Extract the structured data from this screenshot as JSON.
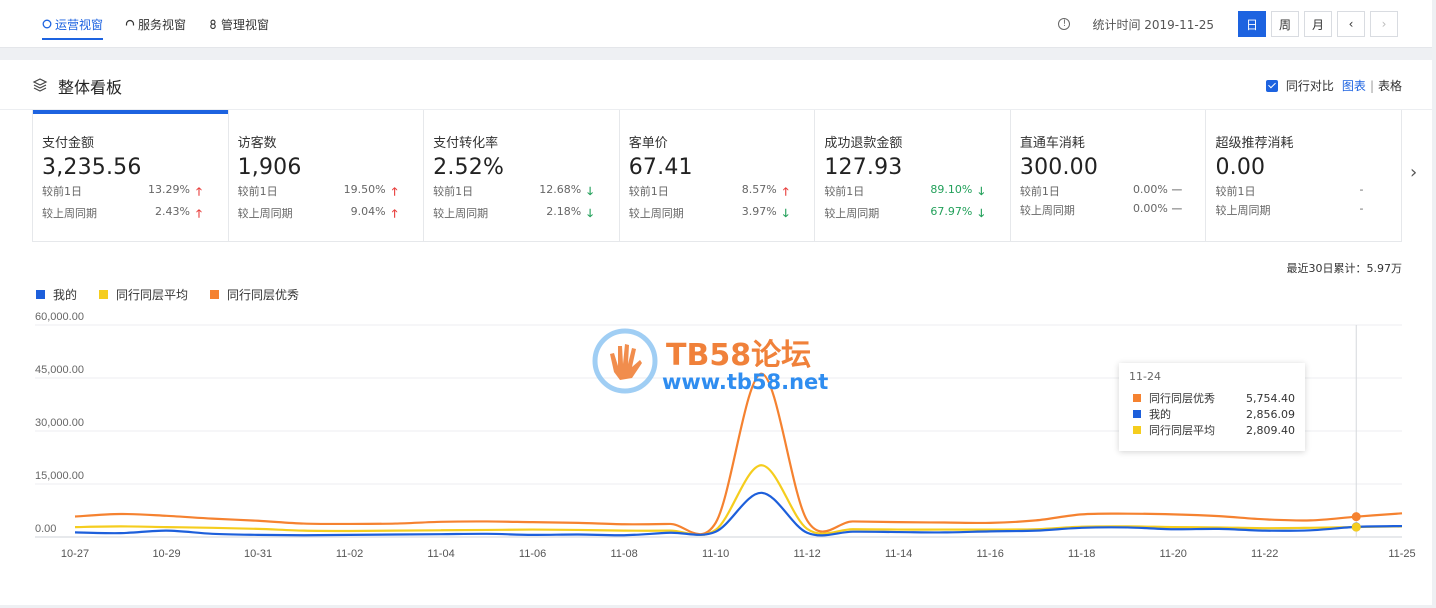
{
  "nav": {
    "tabs": [
      {
        "label": "运营视窗",
        "active": true
      },
      {
        "label": "服务视窗",
        "active": false
      },
      {
        "label": "管理视窗",
        "active": false
      }
    ],
    "stat_time": "统计时间 2019-11-25",
    "date_buttons": [
      "日",
      "周",
      "月"
    ],
    "prev_label": "‹",
    "next_label": "›"
  },
  "panel": {
    "title": "整体看板",
    "compare_label": "同行对比",
    "chart_link": "图表",
    "separator": "|",
    "table_link": "表格"
  },
  "cards": [
    {
      "name": "支付金额",
      "value": "3,235.56",
      "rows": [
        {
          "label": "较前1日",
          "val": "13.29%",
          "dir": "up"
        },
        {
          "label": "较上周同期",
          "val": "2.43%",
          "dir": "up"
        }
      ]
    },
    {
      "name": "访客数",
      "value": "1,906",
      "rows": [
        {
          "label": "较前1日",
          "val": "19.50%",
          "dir": "up"
        },
        {
          "label": "较上周同期",
          "val": "9.04%",
          "dir": "up"
        }
      ]
    },
    {
      "name": "支付转化率",
      "value": "2.52%",
      "rows": [
        {
          "label": "较前1日",
          "val": "12.68%",
          "dir": "down"
        },
        {
          "label": "较上周同期",
          "val": "2.18%",
          "dir": "down"
        }
      ]
    },
    {
      "name": "客单价",
      "value": "67.41",
      "rows": [
        {
          "label": "较前1日",
          "val": "8.57%",
          "dir": "up"
        },
        {
          "label": "较上周同期",
          "val": "3.97%",
          "dir": "down"
        }
      ]
    },
    {
      "name": "成功退款金额",
      "value": "127.93",
      "rows": [
        {
          "label": "较前1日",
          "val": "89.10%",
          "dir": "down-green"
        },
        {
          "label": "较上周同期",
          "val": "67.97%",
          "dir": "down-green"
        }
      ]
    },
    {
      "name": "直通车消耗",
      "value": "300.00",
      "rows": [
        {
          "label": "较前1日",
          "val": "0.00%",
          "dir": "flat"
        },
        {
          "label": "较上周同期",
          "val": "0.00%",
          "dir": "flat"
        }
      ]
    },
    {
      "name": "超级推荐消耗",
      "value": "0.00",
      "rows": [
        {
          "label": "较前1日",
          "val": "-",
          "dir": "none"
        },
        {
          "label": "较上周同期",
          "val": "-",
          "dir": "none"
        }
      ]
    }
  ],
  "arrows": {
    "up": "🡑",
    "down": "🡓",
    "flat": "—"
  },
  "sum_text": "最近30日累计：5.97万",
  "colors": {
    "mine": "#1d5fdb",
    "avg": "#f5cd1e",
    "top": "#f58230",
    "accent": "#1d63e0"
  },
  "tooltip": {
    "title": "11-24",
    "rows": [
      {
        "name": "同行同层优秀",
        "value": "5,754.40",
        "color": "#f58230"
      },
      {
        "name": "我的",
        "value": "2,856.09",
        "color": "#1d5fdb"
      },
      {
        "name": "同行同层平均",
        "value": "2,809.40",
        "color": "#f5cd1e"
      }
    ]
  },
  "watermark": {
    "title": "TB58论坛",
    "url": "www.tb58.net"
  },
  "chart_data": {
    "type": "line",
    "x": [
      "10-27",
      "10-28",
      "10-29",
      "10-30",
      "10-31",
      "11-01",
      "11-02",
      "11-03",
      "11-04",
      "11-05",
      "11-06",
      "11-07",
      "11-08",
      "11-09",
      "11-10",
      "11-11",
      "11-12",
      "11-13",
      "11-14",
      "11-15",
      "11-16",
      "11-17",
      "11-18",
      "11-19",
      "11-20",
      "11-21",
      "11-22",
      "11-23",
      "11-24",
      "11-25"
    ],
    "x_tick_labels": [
      "10-27",
      "10-29",
      "10-31",
      "11-02",
      "11-04",
      "11-06",
      "11-08",
      "11-10",
      "11-12",
      "11-14",
      "11-16",
      "11-18",
      "11-20",
      "11-22",
      "11-25"
    ],
    "y_tick_labels": [
      "0.00",
      "15,000.00",
      "30,000.00",
      "45,000.00",
      "60,000.00"
    ],
    "ylim": [
      0,
      60000
    ],
    "series": [
      {
        "name": "我的",
        "color": "#1d5fdb",
        "values": [
          1300,
          1100,
          1800,
          900,
          600,
          500,
          600,
          700,
          800,
          900,
          600,
          700,
          500,
          1200,
          1500,
          12500,
          1200,
          1500,
          1400,
          1300,
          1600,
          1800,
          2600,
          2700,
          2200,
          2300,
          1800,
          1900,
          2856.09,
          3100
        ]
      },
      {
        "name": "同行同层平均",
        "value_hint": "",
        "color": "#f5cd1e",
        "values": [
          2800,
          3000,
          2800,
          2600,
          2300,
          1800,
          1700,
          1800,
          1900,
          2000,
          2100,
          2000,
          1800,
          1800,
          2000,
          20300,
          2300,
          2200,
          2100,
          2100,
          2100,
          2200,
          2900,
          3000,
          2800,
          2700,
          2500,
          2600,
          2809.4,
          3000
        ]
      },
      {
        "name": "同行同层优秀",
        "color": "#f58230",
        "values": [
          5800,
          6500,
          6000,
          5200,
          4600,
          3800,
          3700,
          3800,
          4300,
          4400,
          4200,
          4000,
          3600,
          3700,
          4000,
          46200,
          4700,
          4400,
          4200,
          4100,
          4000,
          4700,
          6400,
          6600,
          6400,
          5900,
          5000,
          4700,
          5754.4,
          6700
        ]
      }
    ],
    "legend": "top-left",
    "grid": true,
    "highlight_index": 28
  }
}
